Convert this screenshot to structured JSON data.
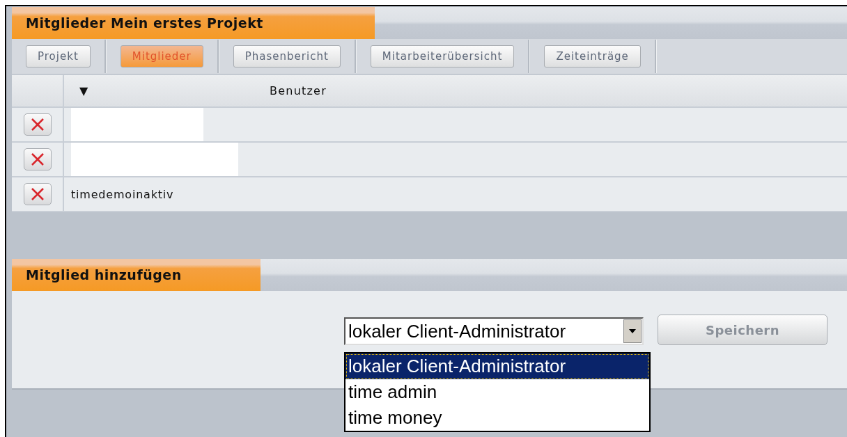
{
  "header": {
    "title": "Mitglieder Mein erstes Projekt"
  },
  "tabs": [
    {
      "label": "Projekt",
      "selected": false
    },
    {
      "label": "Mitglieder",
      "selected": true
    },
    {
      "label": "Phasenbericht",
      "selected": false
    },
    {
      "label": "Mitarbeiterübersicht",
      "selected": false
    },
    {
      "label": "Zeiteinträge",
      "selected": false
    }
  ],
  "table": {
    "sort_icon": "▼",
    "columns": [
      "Benutzer"
    ],
    "rows": [
      {
        "redacted": true
      },
      {
        "redacted": true
      },
      {
        "redacted": false,
        "user": "timedemoinaktiv"
      }
    ]
  },
  "add_section": {
    "title": "Mitglied hinzufügen",
    "select": {
      "value": "lokaler Client-Administrator",
      "expanded": true,
      "options": [
        {
          "label": "lokaler Client-Administrator",
          "selected": true
        },
        {
          "label": "time admin",
          "selected": false
        },
        {
          "label": "time money",
          "selected": false
        }
      ]
    },
    "save_button": {
      "label": "Speichern",
      "disabled": true
    }
  }
}
